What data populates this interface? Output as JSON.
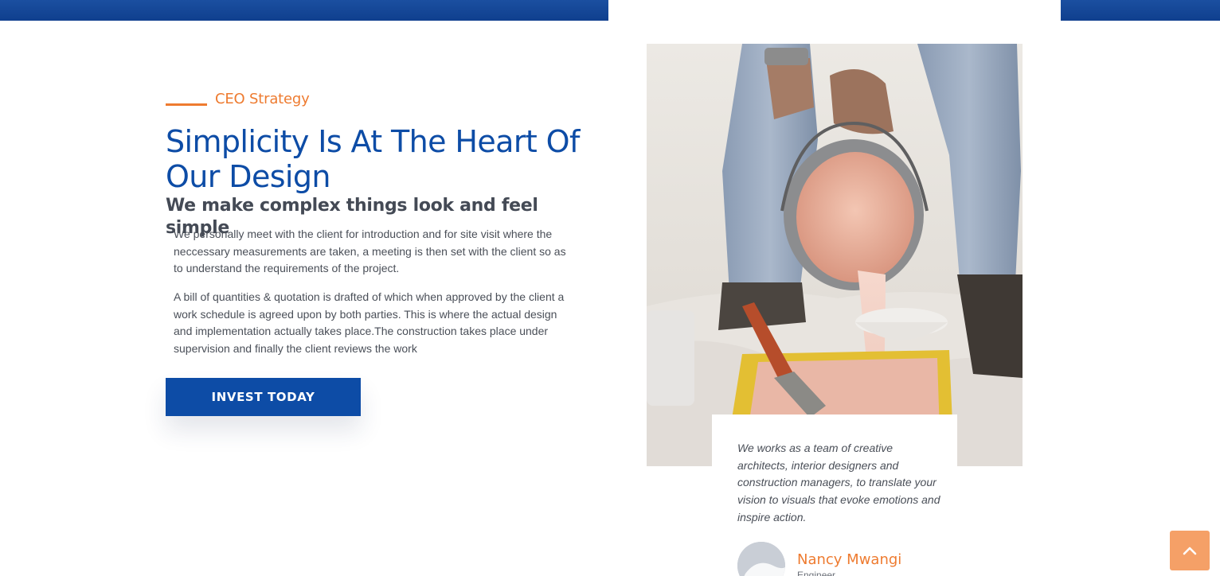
{
  "hero": {
    "eyebrow": "CEO Strategy",
    "heading": "Simplicity Is At The Heart Of Our Design",
    "subheading": "We make complex things look and feel simple",
    "paragraphs": [
      "We personally meet with the client for introduction and for site visit where the neccessary measurements are taken, a meeting is then set with the client so as to understand the requirements of the project.",
      "A bill of quantities & quotation is drafted of which when approved by the client a work schedule is agreed upon by both parties. This is where the actual design and implementation actually takes place.The construction takes place under supervision and finally the client reviews the work"
    ],
    "cta_label": "INVEST TODAY"
  },
  "testimonial": {
    "quote": "We works as a team of creative architects, interior designers and construction managers, to translate your vision to visuals that evoke emotions and inspire action.",
    "author_name": "Nancy Mwangi",
    "author_role": "Engineer"
  },
  "icons": {
    "back_to_top": "chevron-up-icon",
    "avatar": "avatar-image"
  },
  "colors": {
    "brand_blue": "#0d4ca6",
    "accent_orange": "#ee7b30",
    "back_to_top_bg": "#f5a067",
    "body_text": "#4a4f58"
  }
}
